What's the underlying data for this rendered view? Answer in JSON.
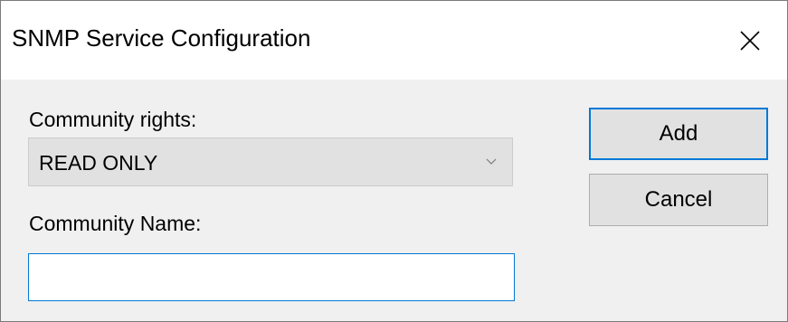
{
  "dialog": {
    "title": "SNMP Service Configuration",
    "close_icon": "close-icon"
  },
  "form": {
    "community_rights_label": "Community rights:",
    "community_rights_value": "READ ONLY",
    "dropdown_icon": "chevron-down-icon",
    "community_name_label": "Community Name:",
    "community_name_value": "",
    "community_name_placeholder": ""
  },
  "buttons": {
    "add_label": "Add",
    "cancel_label": "Cancel"
  },
  "colors": {
    "accent": "#0078d7",
    "button_face": "#e1e1e1",
    "dialog_background": "#f0f0f0",
    "titlebar_background": "#ffffff"
  }
}
